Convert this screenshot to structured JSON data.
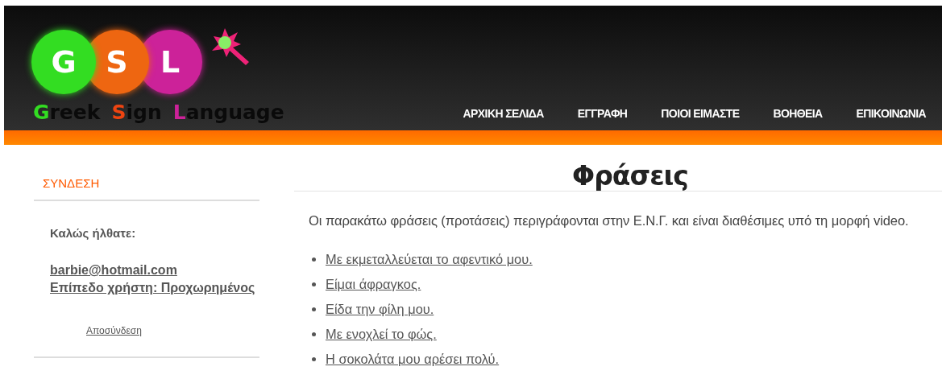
{
  "logo": {
    "circles": [
      {
        "letter": "G",
        "color": "#33dd22"
      },
      {
        "letter": "S",
        "color": "#ee6611"
      },
      {
        "letter": "L",
        "color": "#cc2299"
      }
    ],
    "caption": [
      {
        "initial": "G",
        "rest": "reek",
        "color": "#33dd22"
      },
      {
        "initial": "S",
        "rest": "ign",
        "color": "#ee4411"
      },
      {
        "initial": "L",
        "rest": "anguage",
        "color": "#cc2299"
      }
    ]
  },
  "nav": [
    "ΑΡΧΙΚΗ ΣΕΛΙΔΑ",
    "ΕΓΓΡΑΦΗ",
    "ΠΟΙΟΙ ΕΙΜΑΣΤΕ",
    "ΒΟΗΘΕΙΑ",
    "ΕΠΙΚΟΙΝΩΝΙΑ"
  ],
  "sidebar": {
    "title": "ΣΥΝΔΕΣΗ",
    "welcome": "Καλώς ήλθατε:",
    "email": "barbie@hotmail.com",
    "user_level": "Επίπεδο χρήστη: Προχωρημένος",
    "logout": "Αποσύνδεση"
  },
  "main": {
    "title": "Φράσεις",
    "intro": "Οι παρακάτω φράσεις (προτάσεις) περιγράφονται στην Ε.Ν.Γ. και είναι διαθέσιμες υπό τη μορφή video.",
    "phrases": [
      "Με εκμεταλλεύεται το αφεντικό μου.",
      "Είμαι άφραγκος.",
      "Είδα την φίλη μου.",
      "Με ενοχλεί το φώς.",
      "Η σοκολάτα μου αρέσει πολύ."
    ]
  }
}
